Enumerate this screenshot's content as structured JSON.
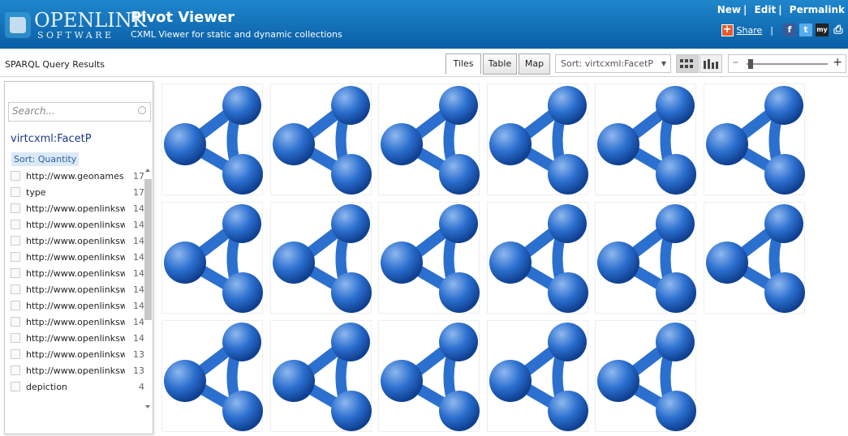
{
  "header": {
    "logo_text": "OPENLINK",
    "logo_subtext": "SOFTWARE",
    "app_title": "Pivot Viewer",
    "app_subtitle": "CXML Viewer for static and dynamic collections",
    "links": [
      "New",
      "Edit",
      "Permalink"
    ],
    "share_label": "Share",
    "social_icons": [
      "facebook-icon",
      "twitter-icon",
      "myspace-icon",
      "print-icon"
    ]
  },
  "toolbar": {
    "title": "SPARQL Query Results",
    "tabs": [
      "Tiles",
      "Table",
      "Map"
    ],
    "active_tab": "Tiles",
    "sort_label": "Sort: virtcxml:FacetP",
    "zoom_level": 0.02
  },
  "sidebar": {
    "search_placeholder": "Search...",
    "facet_name": "virtcxml:FacetP",
    "sort_label": "Sort: Quantity",
    "facets": [
      {
        "label": "http://www.geonames.org",
        "count": "17"
      },
      {
        "label": "type",
        "count": "17"
      },
      {
        "label": "http://www.openlinksw.com",
        "count": "14"
      },
      {
        "label": "http://www.openlinksw.com",
        "count": "14"
      },
      {
        "label": "http://www.openlinksw.com",
        "count": "14"
      },
      {
        "label": "http://www.openlinksw.com",
        "count": "14"
      },
      {
        "label": "http://www.openlinksw.com",
        "count": "14"
      },
      {
        "label": "http://www.openlinksw.com",
        "count": "14"
      },
      {
        "label": "http://www.openlinksw.com",
        "count": "14"
      },
      {
        "label": "http://www.openlinksw.com",
        "count": "14"
      },
      {
        "label": "http://www.openlinksw.com",
        "count": "14"
      },
      {
        "label": "http://www.openlinksw.com",
        "count": "13"
      },
      {
        "label": "http://www.openlinksw.com",
        "count": "13"
      },
      {
        "label": "depiction",
        "count": "4"
      }
    ]
  },
  "tiles": {
    "count": 17,
    "icon": "rdf-molecule-icon",
    "colors": {
      "ball": "#2b6fcf",
      "ball_dark": "#0f3f8f",
      "ball_light": "#8fb8ee"
    }
  },
  "colors": {
    "header": "#0a68b0",
    "accent": "#1a3a8a"
  }
}
